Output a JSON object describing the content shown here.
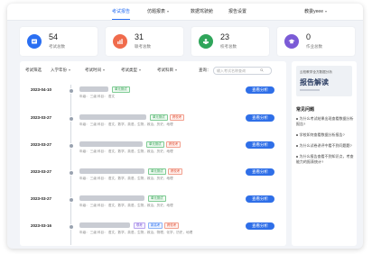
{
  "nav": {
    "items": [
      {
        "label": "考试报告",
        "active": true
      },
      {
        "label": "仿题报表",
        "dropdown": true
      },
      {
        "label": "数据驾驶舱"
      },
      {
        "label": "报告设置"
      }
    ],
    "user": "教委yeee"
  },
  "stats": [
    {
      "value": "54",
      "label": "考试总数",
      "color": "#2a6ff2",
      "bg": "#e7efff",
      "icon": "document-icon"
    },
    {
      "value": "31",
      "label": "联考总数",
      "color": "#f06b4c",
      "bg": "#fde9e4",
      "icon": "chart-icon"
    },
    {
      "value": "23",
      "label": "校考总数",
      "color": "#2fa55a",
      "bg": "#e5f5ea",
      "icon": "people-icon"
    },
    {
      "value": "0",
      "label": "作业总数",
      "color": "#7b5bd6",
      "bg": "#eee8fb",
      "icon": "graduation-cap-icon"
    }
  ],
  "filters": {
    "exam_filter_label": "考试筛选",
    "selects": [
      "入学年份",
      "考试时间",
      "考试类型",
      "考试科目"
    ],
    "search_label": "查询：",
    "search_placeholder": "输入考试名称查询"
  },
  "exams": [
    {
      "date": "2023-04-10",
      "meta": "年级： 三级    科目： 语文",
      "tags": [
        {
          "text": "单元测试",
          "color": "green"
        }
      ],
      "action": "查看分析"
    },
    {
      "date": "2023-03-27",
      "meta": "年级： 三级    科目： 语文，数学，英语，生物，政治，历史，地理",
      "tags": [
        {
          "text": "单元测试",
          "color": "green"
        },
        {
          "text": "跨校考",
          "color": "red"
        }
      ],
      "action": "查看分析"
    },
    {
      "date": "2023-03-27",
      "meta": "年级： 三级    科目： 语文，数学，英语，生物，政治，历史，地理",
      "tags": [
        {
          "text": "单元测试",
          "color": "green"
        },
        {
          "text": "跨校考",
          "color": "red"
        }
      ],
      "action": "查看分析"
    },
    {
      "date": "2023-03-27",
      "meta": "年级： 三级    科目： 语文，数学，英语，生物，政治，历史，地理",
      "tags": [
        {
          "text": "单元测试",
          "color": "green"
        },
        {
          "text": "跨校考",
          "color": "red"
        }
      ],
      "action": "查看分析"
    },
    {
      "date": "2023-03-27",
      "meta": "年级： 三级    科目： 语文，数学，英语，生物，政治，历史，地理",
      "tags": [
        {
          "text": "单元测试",
          "color": "green"
        }
      ],
      "action": "查看分析"
    },
    {
      "date": "2023-03-16",
      "meta": "年级： 三级    科目： 语文，数学，英语，生物，政治，物理，化学，历史，地理",
      "tags": [
        {
          "text": "联考",
          "color": "purple"
        },
        {
          "text": "新高考",
          "color": "blue"
        },
        {
          "text": "跨校考",
          "color": "red"
        }
      ],
      "action": "查看分析"
    }
  ],
  "sidebar": {
    "banner_line": "云校教学全方数据分析",
    "banner_title": "报告解读",
    "faq_title": "常见问题",
    "faqs": [
      "为什么考试结果出现查看数据分析报告?",
      "学校如何查看数据分析报告?",
      "为什么试卷讲评中看不到问题题?",
      "为什么报告查看不到知识点，考查能力的报表统计?"
    ]
  }
}
